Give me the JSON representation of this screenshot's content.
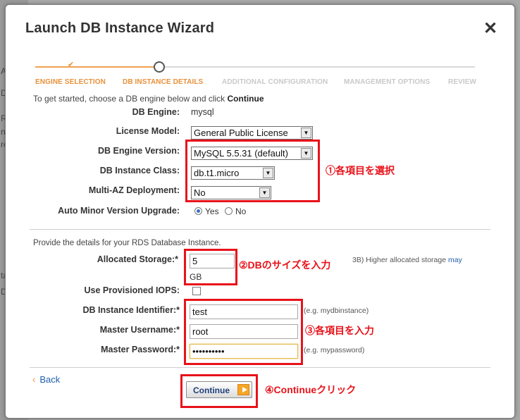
{
  "background": {
    "letters": [
      "A",
      "D",
      "R",
      "nd",
      "re",
      "ta",
      "D"
    ]
  },
  "dialog": {
    "title": "Launch DB Instance Wizard",
    "close": "✕"
  },
  "steps": [
    {
      "label": "ENGINE SELECTION",
      "state": "done"
    },
    {
      "label": "DB INSTANCE DETAILS",
      "state": "active"
    },
    {
      "label": "ADDITIONAL CONFIGURATION",
      "state": "pending"
    },
    {
      "label": "MANAGEMENT OPTIONS",
      "state": "pending"
    },
    {
      "label": "REVIEW",
      "state": "pending"
    }
  ],
  "step_check": "✔",
  "intro": {
    "text": "To get started, choose a DB engine below and click ",
    "bold": "Continue"
  },
  "form": {
    "engine_label": "DB Engine:",
    "engine_value": "mysql",
    "license_label": "License Model:",
    "license_value": "General Public License",
    "version_label": "DB Engine Version:",
    "version_value": "MySQL 5.5.31 (default)",
    "class_label": "DB Instance Class:",
    "class_value": "db.t1.micro",
    "multiaz_label": "Multi-AZ Deployment:",
    "multiaz_value": "No",
    "autominor_label": "Auto Minor Version Upgrade:",
    "autominor_yes": "Yes",
    "autominor_no": "No"
  },
  "section2": {
    "text": "Provide the details for your RDS Database Instance.",
    "storage_label": "Allocated Storage:*",
    "storage_value": "5",
    "storage_unit": "GB",
    "storage_hint": "3B) Higher allocated storage",
    "storage_hint_link": "may",
    "piops_label": "Use Provisioned IOPS:",
    "identifier_label": "DB Instance Identifier:*",
    "identifier_value": "test",
    "identifier_hint": "(e.g. mydbinstance)",
    "username_label": "Master Username:*",
    "username_value": "root",
    "password_label": "Master Password:*",
    "password_value": "••••••••••",
    "password_hint": "(e.g. mypassword)"
  },
  "footer": {
    "back_chev": "‹",
    "back_label": "Back",
    "continue_label": "Continue"
  },
  "annotations": {
    "note1": "①各項目を選択",
    "note2": "②DBのサイズを入力",
    "note3": "③各項目を入力",
    "note4": "④Continueクリック"
  },
  "colors": {
    "accent_orange": "#e8903a",
    "annotation_red": "#e8121a",
    "link_blue": "#1f5fa8"
  }
}
